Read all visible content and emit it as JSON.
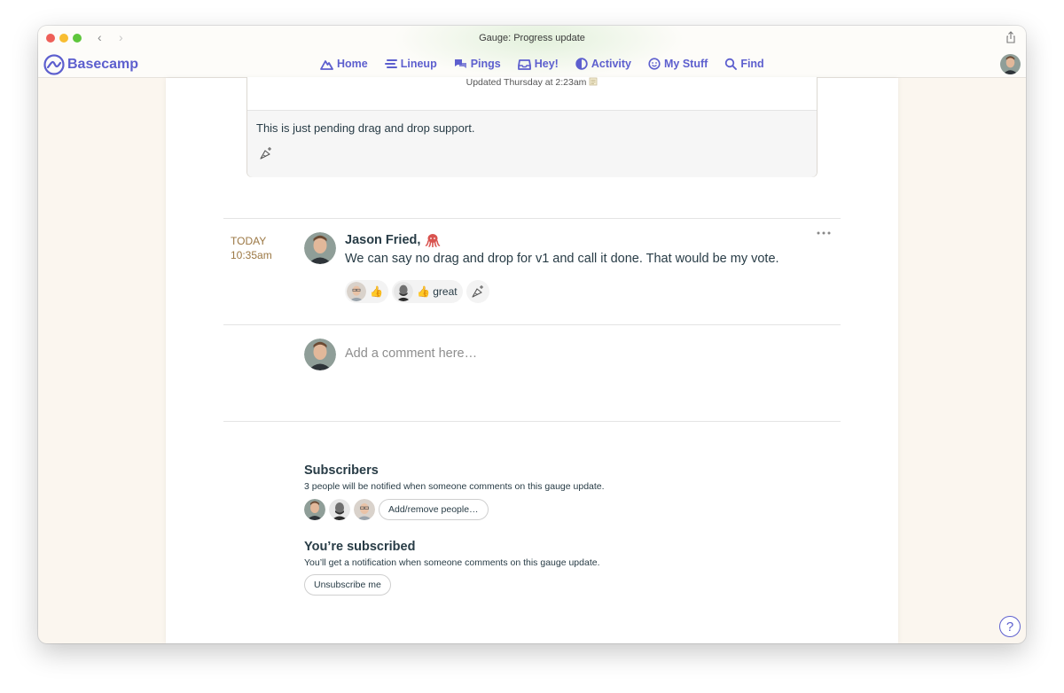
{
  "window": {
    "title": "Gauge: Progress update"
  },
  "brand": {
    "name": "Basecamp",
    "color": "#5d5fce"
  },
  "nav": {
    "items": [
      {
        "label": "Home",
        "icon": "home-mountain-icon"
      },
      {
        "label": "Lineup",
        "icon": "lineup-icon"
      },
      {
        "label": "Pings",
        "icon": "pings-chat-icon"
      },
      {
        "label": "Hey!",
        "icon": "hey-inbox-icon"
      },
      {
        "label": "Activity",
        "icon": "activity-icon"
      },
      {
        "label": "My Stuff",
        "icon": "smiley-icon"
      },
      {
        "label": "Find",
        "icon": "search-icon"
      }
    ]
  },
  "update": {
    "meta": "Updated Thursday at 2:23am",
    "text": "This is just pending drag and drop support."
  },
  "comment": {
    "day": "TODAY",
    "time": "10:35am",
    "author": "Jason Fried,",
    "author_emoji": "octopus-icon",
    "text": "We can say no drag and drop for v1 and call it done. That would be my vote.",
    "boosts": [
      {
        "content": "👍"
      },
      {
        "content": "👍 great"
      }
    ]
  },
  "composer": {
    "placeholder": "Add a comment here…"
  },
  "subscribers": {
    "title": "Subscribers",
    "description": "3 people will be notified when someone comments on this gauge update.",
    "button": "Add/remove people…"
  },
  "subscribed": {
    "title": "You’re subscribed",
    "description": "You’ll get a notification when someone comments on this gauge update.",
    "button": "Unsubscribe me"
  },
  "help": {
    "label": "?"
  }
}
